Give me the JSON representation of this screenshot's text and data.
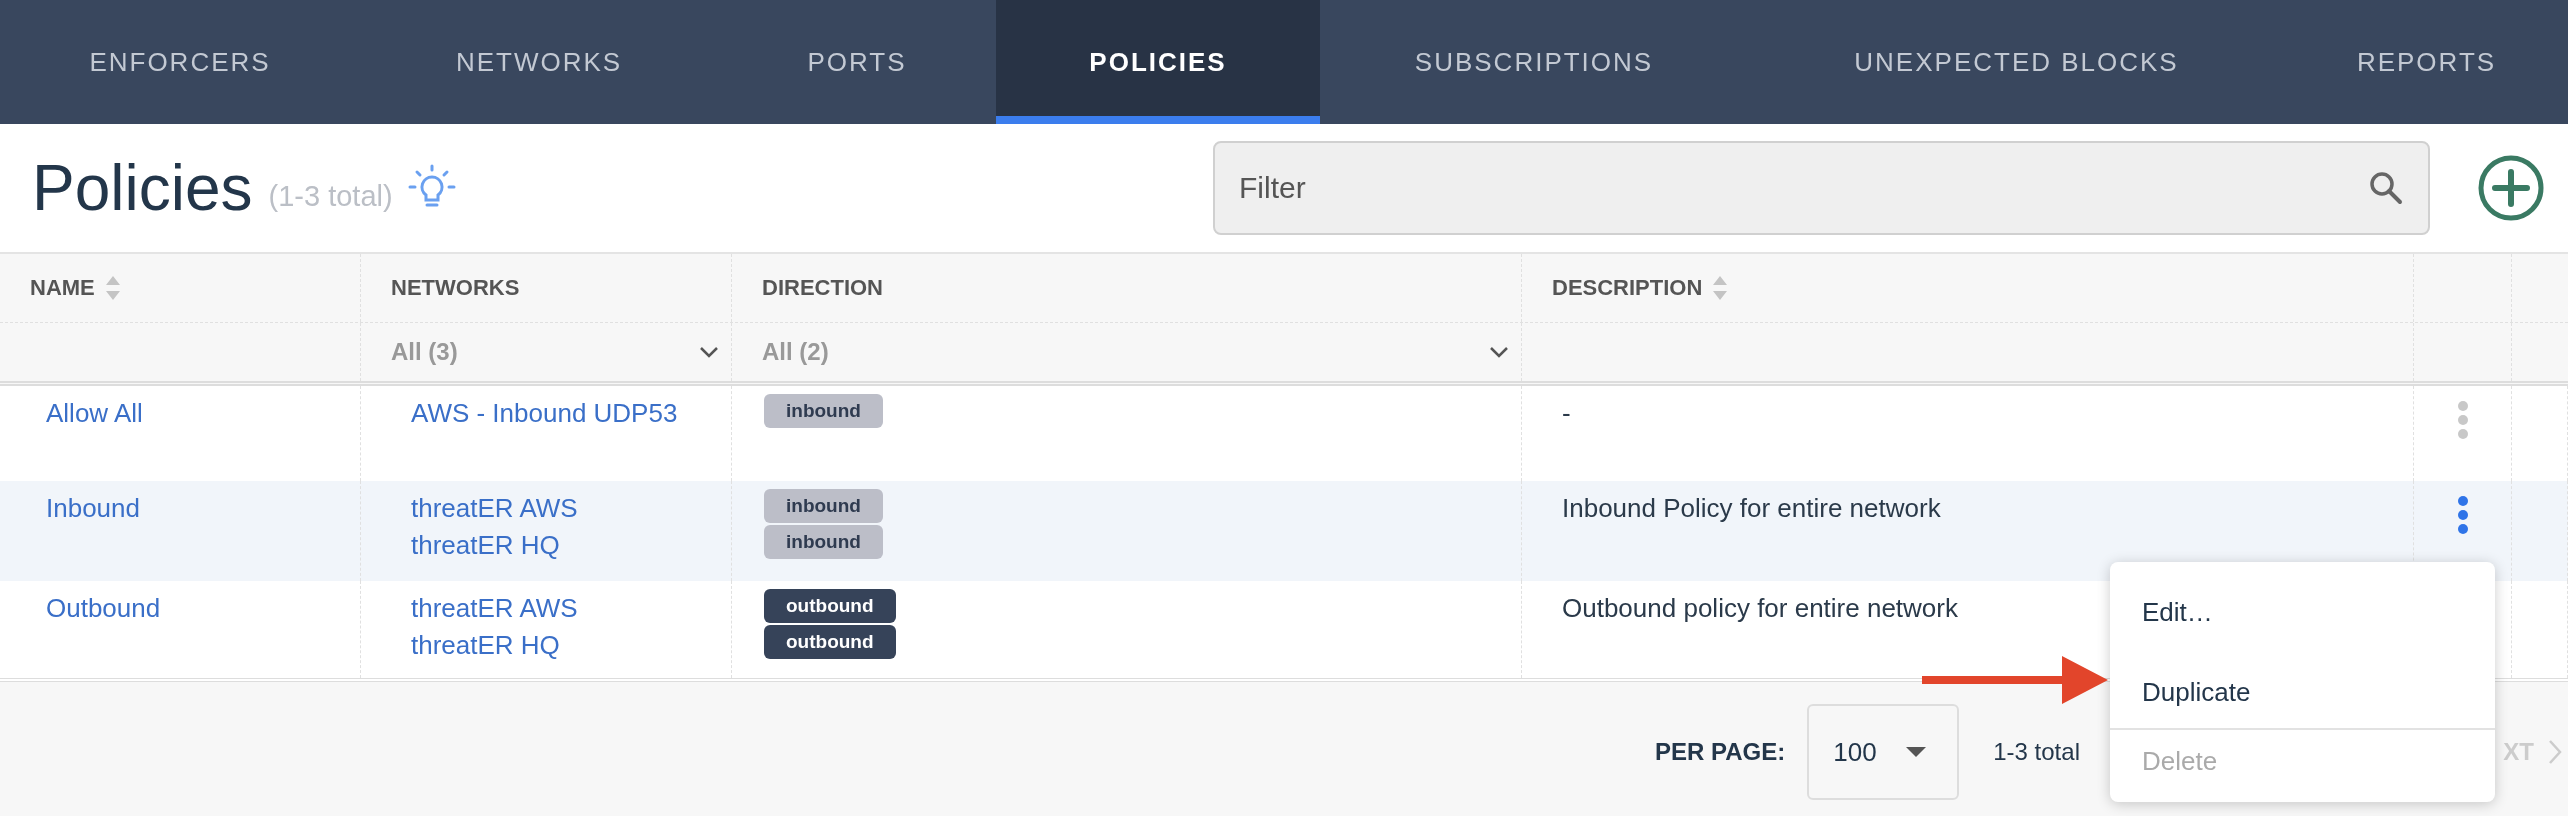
{
  "nav": {
    "tabs": [
      {
        "label": "ENFORCERS",
        "selected": false
      },
      {
        "label": "NETWORKS",
        "selected": false
      },
      {
        "label": "PORTS",
        "selected": false
      },
      {
        "label": "POLICIES",
        "selected": true
      },
      {
        "label": "SUBSCRIPTIONS",
        "selected": false
      },
      {
        "label": "UNEXPECTED BLOCKS",
        "selected": false
      },
      {
        "label": "REPORTS",
        "selected": false
      }
    ]
  },
  "header": {
    "title": "Policies",
    "count": "(1-3 total)"
  },
  "filter": {
    "placeholder": "Filter"
  },
  "table": {
    "columns": [
      {
        "label": "NAME",
        "sortable": true
      },
      {
        "label": "NETWORKS",
        "sortable": false,
        "filter": "All (3)"
      },
      {
        "label": "DIRECTION",
        "sortable": false,
        "filter": "All (2)"
      },
      {
        "label": "DESCRIPTION",
        "sortable": true
      }
    ],
    "rows": [
      {
        "name": "Allow All",
        "networks": [
          "AWS - Inbound UDP53"
        ],
        "directions": [
          {
            "label": "inbound",
            "kind": "inbound"
          }
        ],
        "description": "-",
        "selected": false
      },
      {
        "name": "Inbound",
        "networks": [
          "threatER AWS",
          "threatER HQ"
        ],
        "directions": [
          {
            "label": "inbound",
            "kind": "inbound"
          },
          {
            "label": "inbound",
            "kind": "inbound"
          }
        ],
        "description": "Inbound Policy for entire network",
        "selected": true
      },
      {
        "name": "Outbound",
        "networks": [
          "threatER AWS",
          "threatER HQ"
        ],
        "directions": [
          {
            "label": "outbound",
            "kind": "outbound"
          },
          {
            "label": "outbound",
            "kind": "outbound"
          }
        ],
        "description": "Outbound policy for entire network",
        "selected": false
      }
    ]
  },
  "footer": {
    "per_page_label": "PER PAGE:",
    "per_page": "100",
    "total": "1-3 total",
    "next": "XT"
  },
  "menu": {
    "items": [
      {
        "label": "Edit…",
        "disabled": false
      },
      {
        "label": "Duplicate",
        "disabled": false
      },
      {
        "label": "Delete",
        "disabled": true
      }
    ]
  }
}
